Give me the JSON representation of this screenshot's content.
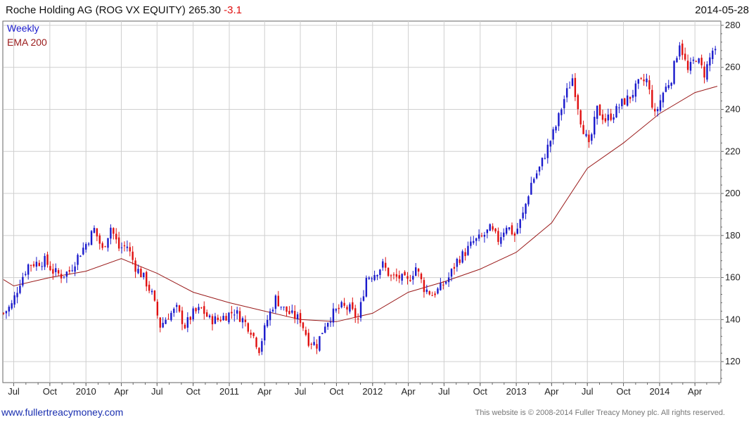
{
  "header": {
    "title": "Roche Holding AG (ROG VX EQUITY)",
    "price": "265.30",
    "change": "-3.1",
    "date": "2014-05-28"
  },
  "legend": {
    "weekly": "Weekly",
    "ema": "EMA 200"
  },
  "footer": {
    "url": "www.fullertreacymoney.com",
    "copyright": "This website is © 2008-2014 Fuller Treacy Money plc. All rights reserved."
  },
  "colors": {
    "up": "#1a1acc",
    "down": "#e01010",
    "ema": "#9a1a1a",
    "grid": "#cfcfcf",
    "axis": "#666666"
  },
  "chart_data": {
    "type": "candlestick",
    "interval": "weekly",
    "ylim": [
      110,
      282
    ],
    "yticks": [
      120,
      140,
      160,
      180,
      200,
      220,
      240,
      260,
      280
    ],
    "x_range": [
      "2009-06-05",
      "2014-06-06"
    ],
    "x_ticks": [
      {
        "date": "2009-07-01",
        "label": "Jul"
      },
      {
        "date": "2009-10-01",
        "label": "Oct"
      },
      {
        "date": "2010-01-01",
        "label": "2010"
      },
      {
        "date": "2010-04-01",
        "label": "Apr"
      },
      {
        "date": "2010-07-01",
        "label": "Jul"
      },
      {
        "date": "2010-10-01",
        "label": "Oct"
      },
      {
        "date": "2011-01-01",
        "label": "2011"
      },
      {
        "date": "2011-04-01",
        "label": "Apr"
      },
      {
        "date": "2011-07-01",
        "label": "Jul"
      },
      {
        "date": "2011-10-01",
        "label": "Oct"
      },
      {
        "date": "2012-01-01",
        "label": "2012"
      },
      {
        "date": "2012-04-01",
        "label": "Apr"
      },
      {
        "date": "2012-07-01",
        "label": "Jul"
      },
      {
        "date": "2012-10-01",
        "label": "Oct"
      },
      {
        "date": "2013-01-01",
        "label": "2013"
      },
      {
        "date": "2013-04-01",
        "label": "Apr"
      },
      {
        "date": "2013-07-01",
        "label": "Jul"
      },
      {
        "date": "2013-10-01",
        "label": "Oct"
      },
      {
        "date": "2014-01-01",
        "label": "2014"
      },
      {
        "date": "2014-04-01",
        "label": "Apr"
      }
    ],
    "close_series": {
      "name": "Weekly",
      "points": [
        [
          "2009-06-05",
          143
        ],
        [
          "2009-06-26",
          147
        ],
        [
          "2009-07-17",
          158
        ],
        [
          "2009-08-07",
          166
        ],
        [
          "2009-08-28",
          167
        ],
        [
          "2009-09-18",
          168
        ],
        [
          "2009-10-09",
          163
        ],
        [
          "2009-10-30",
          161
        ],
        [
          "2009-11-20",
          163
        ],
        [
          "2009-12-11",
          170
        ],
        [
          "2010-01-01",
          176
        ],
        [
          "2010-01-22",
          183
        ],
        [
          "2010-02-12",
          173
        ],
        [
          "2010-03-05",
          184
        ],
        [
          "2010-03-26",
          174
        ],
        [
          "2010-04-16",
          175
        ],
        [
          "2010-05-07",
          165
        ],
        [
          "2010-05-28",
          160
        ],
        [
          "2010-06-18",
          152
        ],
        [
          "2010-07-09",
          137
        ],
        [
          "2010-07-30",
          142
        ],
        [
          "2010-08-20",
          145
        ],
        [
          "2010-09-10",
          137
        ],
        [
          "2010-10-01",
          143
        ],
        [
          "2010-10-22",
          145
        ],
        [
          "2010-11-12",
          140
        ],
        [
          "2010-12-03",
          140
        ],
        [
          "2010-12-24",
          142
        ],
        [
          "2011-01-14",
          144
        ],
        [
          "2011-02-04",
          140
        ],
        [
          "2011-02-25",
          135
        ],
        [
          "2011-03-18",
          126
        ],
        [
          "2011-04-08",
          140
        ],
        [
          "2011-04-29",
          150
        ],
        [
          "2011-05-20",
          145
        ],
        [
          "2011-06-10",
          142
        ],
        [
          "2011-07-01",
          140
        ],
        [
          "2011-07-22",
          130
        ],
        [
          "2011-08-12",
          128
        ],
        [
          "2011-09-02",
          138
        ],
        [
          "2011-09-23",
          143
        ],
        [
          "2011-10-14",
          146
        ],
        [
          "2011-11-04",
          145
        ],
        [
          "2011-11-25",
          140
        ],
        [
          "2011-12-16",
          160
        ],
        [
          "2012-01-06",
          162
        ],
        [
          "2012-01-27",
          166
        ],
        [
          "2012-02-17",
          160
        ],
        [
          "2012-03-09",
          160
        ],
        [
          "2012-03-30",
          158
        ],
        [
          "2012-04-20",
          165
        ],
        [
          "2012-05-11",
          155
        ],
        [
          "2012-06-01",
          152
        ],
        [
          "2012-06-22",
          155
        ],
        [
          "2012-07-13",
          160
        ],
        [
          "2012-08-03",
          168
        ],
        [
          "2012-08-24",
          172
        ],
        [
          "2012-09-14",
          177
        ],
        [
          "2012-10-05",
          179
        ],
        [
          "2012-10-26",
          183
        ],
        [
          "2012-11-16",
          178
        ],
        [
          "2012-12-07",
          185
        ],
        [
          "2012-12-28",
          180
        ],
        [
          "2013-01-18",
          190
        ],
        [
          "2013-02-08",
          205
        ],
        [
          "2013-03-01",
          212
        ],
        [
          "2013-03-22",
          222
        ],
        [
          "2013-04-12",
          232
        ],
        [
          "2013-05-03",
          245
        ],
        [
          "2013-05-24",
          255
        ],
        [
          "2013-06-14",
          235
        ],
        [
          "2013-07-05",
          222
        ],
        [
          "2013-07-26",
          240
        ],
        [
          "2013-08-16",
          235
        ],
        [
          "2013-09-06",
          238
        ],
        [
          "2013-09-27",
          243
        ],
        [
          "2013-10-18",
          246
        ],
        [
          "2013-11-08",
          252
        ],
        [
          "2013-11-29",
          254
        ],
        [
          "2013-12-20",
          237
        ],
        [
          "2014-01-10",
          248
        ],
        [
          "2014-01-31",
          255
        ],
        [
          "2014-02-21",
          272
        ],
        [
          "2014-03-14",
          258
        ],
        [
          "2014-04-04",
          265
        ],
        [
          "2014-04-25",
          257
        ],
        [
          "2014-05-16",
          268
        ],
        [
          "2014-05-28",
          265.3
        ]
      ]
    },
    "ema_series": {
      "name": "EMA 200",
      "points": [
        [
          "2009-06-05",
          159
        ],
        [
          "2009-07-01",
          156
        ],
        [
          "2009-10-01",
          160
        ],
        [
          "2010-01-01",
          163
        ],
        [
          "2010-04-01",
          169
        ],
        [
          "2010-07-01",
          162
        ],
        [
          "2010-10-01",
          153
        ],
        [
          "2011-01-01",
          148
        ],
        [
          "2011-04-01",
          144
        ],
        [
          "2011-07-01",
          140
        ],
        [
          "2011-10-01",
          139
        ],
        [
          "2012-01-01",
          143
        ],
        [
          "2012-04-01",
          153
        ],
        [
          "2012-07-01",
          158
        ],
        [
          "2012-10-01",
          164
        ],
        [
          "2013-01-01",
          172
        ],
        [
          "2013-04-01",
          186
        ],
        [
          "2013-07-01",
          212
        ],
        [
          "2013-10-01",
          224
        ],
        [
          "2014-01-01",
          238
        ],
        [
          "2014-04-01",
          248
        ],
        [
          "2014-05-28",
          251
        ]
      ]
    },
    "y_axis_side": "right",
    "grid": true,
    "legend_position": "top-left"
  }
}
